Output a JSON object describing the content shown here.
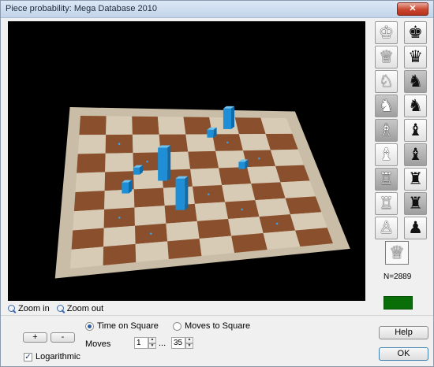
{
  "window": {
    "title": "Piece probability: Mega Database 2010",
    "close_glyph": "✕"
  },
  "zoom": {
    "zoom_in_label": "Zoom in",
    "zoom_out_label": "Zoom out"
  },
  "controls": {
    "plus_label": "+",
    "minus_label": "-",
    "mode_options": [
      "Time on Square",
      "Moves to Square"
    ],
    "mode_selected": "Time on Square",
    "moves_label": "Moves",
    "moves_from": "1",
    "moves_sep": "...",
    "moves_to": "35",
    "logarithmic_label": "Logarithmic",
    "logarithmic_checked": true
  },
  "piece_panel": {
    "pieces": [
      {
        "name": "white-king",
        "glyph": "♔"
      },
      {
        "name": "black-king",
        "glyph": "♚"
      },
      {
        "name": "white-queen",
        "glyph": "♕"
      },
      {
        "name": "black-queen",
        "glyph": "♛"
      },
      {
        "name": "white-knight",
        "glyph": "♘"
      },
      {
        "name": "black-knight",
        "glyph": "♞"
      },
      {
        "name": "white-knight-2",
        "glyph": "♞"
      },
      {
        "name": "black-knight-2",
        "glyph": "♞"
      },
      {
        "name": "white-bishop",
        "glyph": "♗"
      },
      {
        "name": "black-bishop",
        "glyph": "♝"
      },
      {
        "name": "white-bishop-2",
        "glyph": "♝"
      },
      {
        "name": "black-bishop-2",
        "glyph": "♝"
      },
      {
        "name": "white-rook",
        "glyph": "♖"
      },
      {
        "name": "black-rook",
        "glyph": "♜"
      },
      {
        "name": "white-rook-2",
        "glyph": "♖"
      },
      {
        "name": "black-rook-2",
        "glyph": "♜"
      },
      {
        "name": "white-pawn",
        "glyph": "♙"
      },
      {
        "name": "black-pawn",
        "glyph": "♟"
      }
    ],
    "selected_piece_glyph": "♕",
    "count_text": "N=2889",
    "indicator_color": "#0a6e08"
  },
  "buttons": {
    "help_label": "Help",
    "ok_label": "OK"
  },
  "colors": {
    "board_light": "#d7cbb6",
    "board_dark": "#8a4f2c",
    "bar_color": "#1e8fd6"
  }
}
